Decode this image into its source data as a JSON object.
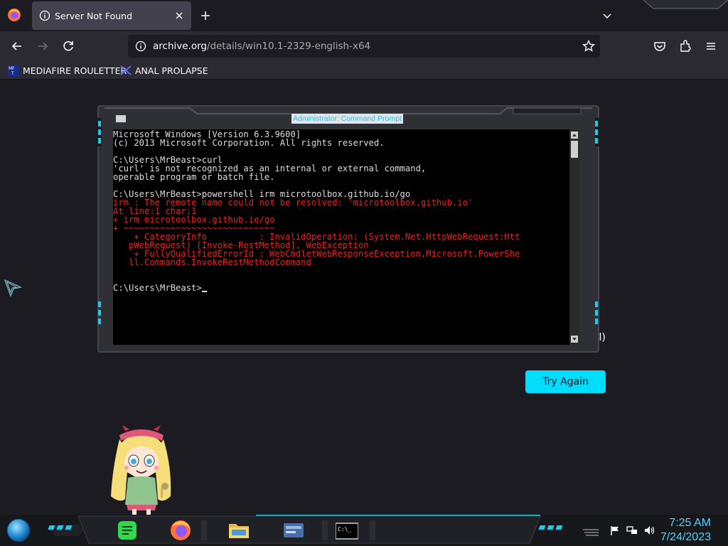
{
  "browser": {
    "tab_title": "Server Not Found",
    "url_host": "archive.org",
    "url_path": "/details/win10.1-2329-english-x64",
    "bookmarks": [
      {
        "label": "MEDIAFIRE ROULETTER",
        "icon": "mediafire-icon"
      },
      {
        "label": "ANAL PROLAPSE",
        "icon": "bookmark-logo-icon"
      }
    ]
  },
  "page": {
    "partial_text": "all)",
    "try_again_label": "Try Again"
  },
  "cmd": {
    "title": "Administrator: Command Prompt",
    "lines": [
      {
        "t": "Microsoft Windows [Version 6.3.9600]",
        "c": "w"
      },
      {
        "t": "(c) 2013 Microsoft Corporation. All rights reserved.",
        "c": "w"
      },
      {
        "t": "",
        "c": "w"
      },
      {
        "t": "C:\\Users\\MrBeast>curl",
        "c": "w"
      },
      {
        "t": "'curl' is not recognized as an internal or external command,",
        "c": "w"
      },
      {
        "t": "operable program or batch file.",
        "c": "w"
      },
      {
        "t": "",
        "c": "w"
      },
      {
        "t": "C:\\Users\\MrBeast>powershell irm microtoolbox.github.io/go",
        "c": "w"
      },
      {
        "t": "irm : The remote name could not be resolved: 'microtoolbox.github.io'",
        "c": "r"
      },
      {
        "t": "At line:1 char:1",
        "c": "r"
      },
      {
        "t": "+ irm microtoolbox.github.io/go",
        "c": "r"
      },
      {
        "t": "+ ~~~~~~~~~~~~~~~~~~~~~~~~~~~~~",
        "c": "r"
      },
      {
        "t": "    + CategoryInfo          : InvalidOperation: (System.Net.HttpWebRequest:Htt",
        "c": "r"
      },
      {
        "t": "   pWebRequest) [Invoke-RestMethod], WebException",
        "c": "r"
      },
      {
        "t": "    + FullyQualifiedErrorId : WebCmdletWebResponseException,Microsoft.PowerShe",
        "c": "r"
      },
      {
        "t": "   ll.Commands.InvokeRestMethodCommand",
        "c": "r"
      },
      {
        "t": "",
        "c": "w"
      },
      {
        "t": "",
        "c": "w"
      }
    ],
    "prompt": "C:\\Users\\MrBeast>"
  },
  "taskbar": {
    "time": "7:25 AM",
    "date": "7/24/2023",
    "pinned": [
      "start-orb-icon",
      "notes-app-icon",
      "firefox-icon",
      "file-explorer-icon",
      "control-panel-icon",
      "command-prompt-icon"
    ]
  },
  "colors": {
    "accent": "#00ddff",
    "cmd_error": "#e82222",
    "cmd_text": "#dedede",
    "taskbar_clock": "#4ad8ff"
  }
}
